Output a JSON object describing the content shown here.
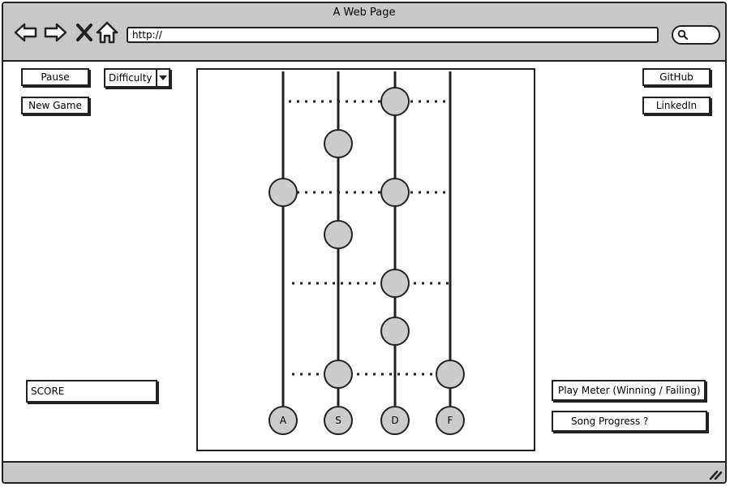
{
  "window": {
    "title": "A Web Page",
    "url": "http://"
  },
  "controls": {
    "pause_label": "Pause",
    "new_game_label": "New Game",
    "difficulty_label": "Difficulty"
  },
  "links": {
    "github_label": "GitHub",
    "linkedin_label": "LinkedIn"
  },
  "score": {
    "label": "SCORE"
  },
  "meters": {
    "play_meter_label": "Play Meter (Winning / Failing)",
    "song_progress_label": "Song Progress ?"
  },
  "game": {
    "lanes": [
      {
        "key": "A"
      },
      {
        "key": "S"
      },
      {
        "key": "D"
      },
      {
        "key": "F"
      }
    ]
  },
  "icons": {
    "back": "arrow-left-icon",
    "forward": "arrow-right-icon",
    "stop": "close-icon",
    "home": "home-icon",
    "search": "search-icon",
    "resize": "resize-grip-icon"
  },
  "colors": {
    "chrome": "#c8c8c8",
    "note_fill": "#cccccc",
    "stroke": "#222222"
  }
}
